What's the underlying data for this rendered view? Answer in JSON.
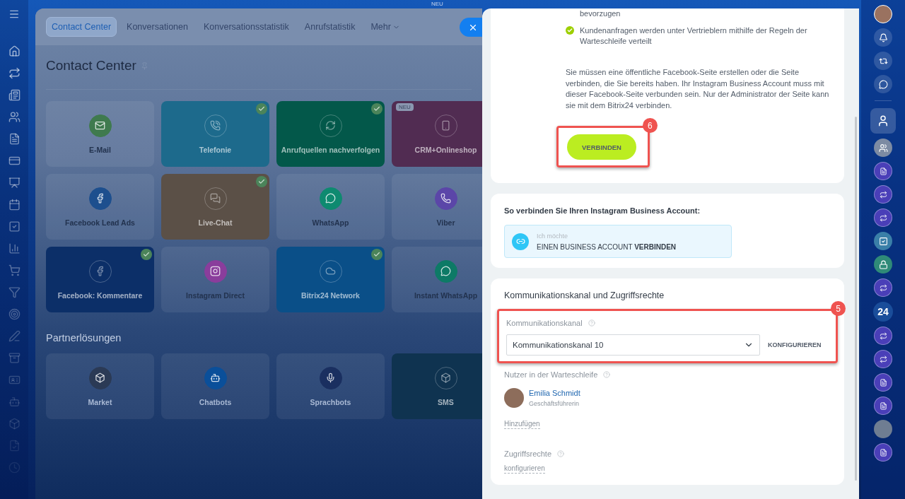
{
  "top_badge": "NEU",
  "backdrop": {
    "tabs": [
      {
        "label": "Contact Center",
        "selected": true
      },
      {
        "label": "Konversationen",
        "selected": false
      },
      {
        "label": "Konversationsstatistik",
        "selected": false
      },
      {
        "label": "Anrufstatistik",
        "selected": false
      },
      {
        "label": "Mehr",
        "selected": false
      }
    ],
    "title": "Contact Center",
    "tiles": [
      {
        "label": "E-Mail",
        "kind": "plain",
        "color": "#3f7a4e",
        "connected": false,
        "new": false
      },
      {
        "label": "Telefonie",
        "kind": "active",
        "color": "#1d6a8c",
        "connected": true,
        "new": false
      },
      {
        "label": "Anrufquellen nachverfolgen",
        "kind": "active",
        "color": "#03584a",
        "connected": true,
        "new": false
      },
      {
        "label": "CRM+Onlineshop",
        "kind": "active",
        "color": "#512c52",
        "connected": false,
        "new": true,
        "new_label": "NEU"
      },
      {
        "label": "Facebook Lead Ads",
        "kind": "plain",
        "color": "#1d4f8e",
        "connected": false,
        "new": false
      },
      {
        "label": "Live-Chat",
        "kind": "active",
        "color": "#5b5047",
        "connected": true,
        "new": false
      },
      {
        "label": "WhatsApp",
        "kind": "plain",
        "color": "#0e8a70",
        "connected": false,
        "new": false
      },
      {
        "label": "Viber",
        "kind": "plain",
        "color": "#5b46a8",
        "connected": false,
        "new": false
      },
      {
        "label": "Facebook: Kommentare",
        "kind": "active",
        "color": "#0c2f68",
        "connected": true,
        "new": false
      },
      {
        "label": "Instagram Direct",
        "kind": "plain",
        "color": "#8a3d9c",
        "connected": false,
        "new": false
      },
      {
        "label": "Bitrix24 Network",
        "kind": "active",
        "color": "#0a4f88",
        "connected": true,
        "new": false
      },
      {
        "label": "Instant WhatsApp",
        "kind": "plain",
        "color": "#0d7a66",
        "connected": false,
        "new": false
      }
    ],
    "partner_title": "Partnerlösungen",
    "partner_tiles": [
      {
        "label": "Market",
        "kind": "plain",
        "color": "#2b3a55",
        "connected": false,
        "new": false
      },
      {
        "label": "Chatbots",
        "kind": "plain",
        "color": "#0a4f9a",
        "connected": false,
        "new": false
      },
      {
        "label": "Sprachbots",
        "kind": "plain",
        "color": "#1a2f60",
        "connected": false,
        "new": false
      },
      {
        "label": "SMS",
        "kind": "active",
        "color": "#0f3350",
        "connected": false,
        "new": false
      }
    ]
  },
  "slider": {
    "feature_tail": "bevorzugen",
    "features": [
      {
        "text": "Kundenanfragen werden unter Vertrieblern mithilfe der Regeln der Warteschleife verteilt"
      }
    ],
    "note": "Sie müssen eine öffentliche Facebook-Seite erstellen oder die Seite verbinden, die Sie bereits haben. Ihr Instagram Business Account muss mit dieser Facebook-Seite verbunden sein. Nur der Administrator der Seite kann sie mit dem Bitrix24 verbinden.",
    "connect_button": "VERBINDEN",
    "connect_step": "6",
    "instagram": {
      "title": "So verbinden Sie Ihren Instagram Business Account:",
      "option_caption": "Ich möchte",
      "option_text": "EINEN BUSINESS ACCOUNT **VERBINDEN**"
    },
    "channel": {
      "title": "Kommunikationskanal und Zugriffsrechte",
      "label": "Kommunikationskanal",
      "value": "Kommunikationskanal 10",
      "configure_button": "KONFIGURIEREN",
      "step": "5",
      "queue_label": "Nutzer in der Warteschleife",
      "users": [
        {
          "name": "Emilia Schmidt",
          "role": "Geschäftsführerin"
        }
      ],
      "add_link": "Hinzufügen",
      "access_label": "Zugriffsrechte",
      "access_link": "konfigurieren"
    }
  },
  "right_bar": {
    "counter": "24"
  }
}
